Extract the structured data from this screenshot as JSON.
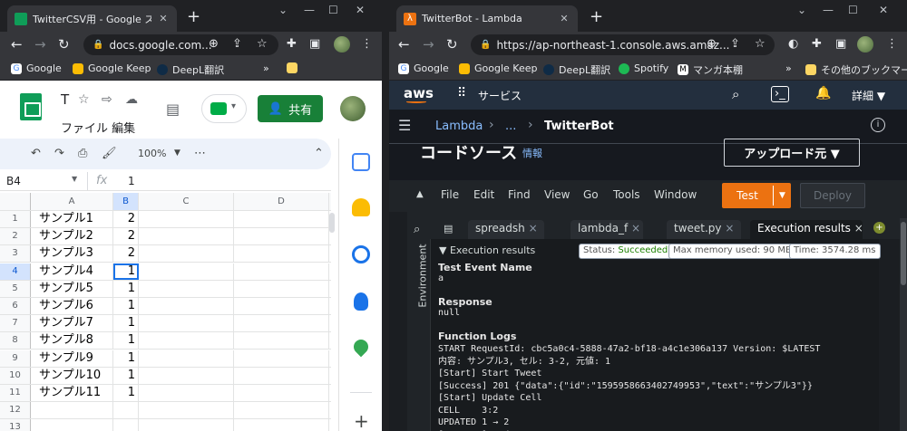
{
  "left_window": {
    "tab_title": "TwitterCSV用 - Google スプレッ",
    "url": "docs.google.com...",
    "bookmarks": [
      "Google",
      "Google Keep",
      "DeepL翻訳"
    ],
    "bookmarks_more": "»",
    "sheets": {
      "title": "T",
      "menu": "ファイル 編集",
      "share_label": "共有",
      "zoom": "100%",
      "cell_ref": "B4",
      "fx_label": "fx",
      "formula_value": "1",
      "columns": [
        "A",
        "B",
        "C",
        "D"
      ],
      "rows": [
        {
          "n": "1",
          "a": "サンプル1",
          "b": "2"
        },
        {
          "n": "2",
          "a": "サンプル2",
          "b": "2"
        },
        {
          "n": "3",
          "a": "サンプル3",
          "b": "2"
        },
        {
          "n": "4",
          "a": "サンプル4",
          "b": "1"
        },
        {
          "n": "5",
          "a": "サンプル5",
          "b": "1"
        },
        {
          "n": "6",
          "a": "サンプル6",
          "b": "1"
        },
        {
          "n": "7",
          "a": "サンプル7",
          "b": "1"
        },
        {
          "n": "8",
          "a": "サンプル8",
          "b": "1"
        },
        {
          "n": "9",
          "a": "サンプル9",
          "b": "1"
        },
        {
          "n": "10",
          "a": "サンプル10",
          "b": "1"
        },
        {
          "n": "11",
          "a": "サンプル11",
          "b": "1"
        },
        {
          "n": "12",
          "a": "",
          "b": ""
        },
        {
          "n": "13",
          "a": "",
          "b": ""
        }
      ],
      "selected_row": "4"
    }
  },
  "right_window": {
    "tab_title": "TwitterBot - Lambda",
    "url": "https://ap-northeast-1.console.aws.amaz...",
    "bookmarks": [
      "Google",
      "Google Keep",
      "DeepL翻訳",
      "Spotify",
      "マンガ本棚"
    ],
    "bookmarks_more": "»",
    "bookmarks_other": "その他のブックマーク",
    "aws": {
      "logo": "aws",
      "services": "サービス",
      "detail": "詳細 ▼",
      "breadcrumb": [
        "Lambda",
        "...",
        "TwitterBot"
      ],
      "section_title": "コードソース",
      "info_link": "情報",
      "upload_button": "アップロード元 ▼",
      "menu": [
        "File",
        "Edit",
        "Find",
        "View",
        "Go",
        "Tools",
        "Window"
      ],
      "test_button": "Test",
      "deploy_button": "Deploy",
      "tabs": [
        "spreadsh",
        "lambda_f",
        "tweet.py",
        "Execution results"
      ],
      "tab_close": "×",
      "rail_label": "Environment",
      "exec_header": "▼ Execution results",
      "status_label": "Status:",
      "status_value": "Succeeded",
      "memory": "Max memory used: 90 MB",
      "time": "Time: 3574.28 ms",
      "test_event_name_label": "Test Event Name",
      "test_event_name": "a",
      "response_label": "Response",
      "response": "null",
      "function_logs_label": "Function Logs",
      "logs": [
        "START RequestId: cbc5a0c4-5888-47a2-bf18-a4c1e306a137 Version: $LATEST",
        "内容: サンプル3, セル: 3-2, 元値: 1",
        "[Start] Start Tweet",
        "[Success] 201 {\"data\":{\"id\":\"1595958663402749953\",\"text\":\"サンプル3\"}}",
        "[Start] Update Cell",
        "CELL    3:2",
        "UPDATED 1 → 2",
        "[Success] Update Done"
      ]
    }
  },
  "colors": {
    "sheets_green": "#188038",
    "aws_orange": "#ec7211",
    "status_green": "#1d8102",
    "chrome_dark": "#202124"
  }
}
